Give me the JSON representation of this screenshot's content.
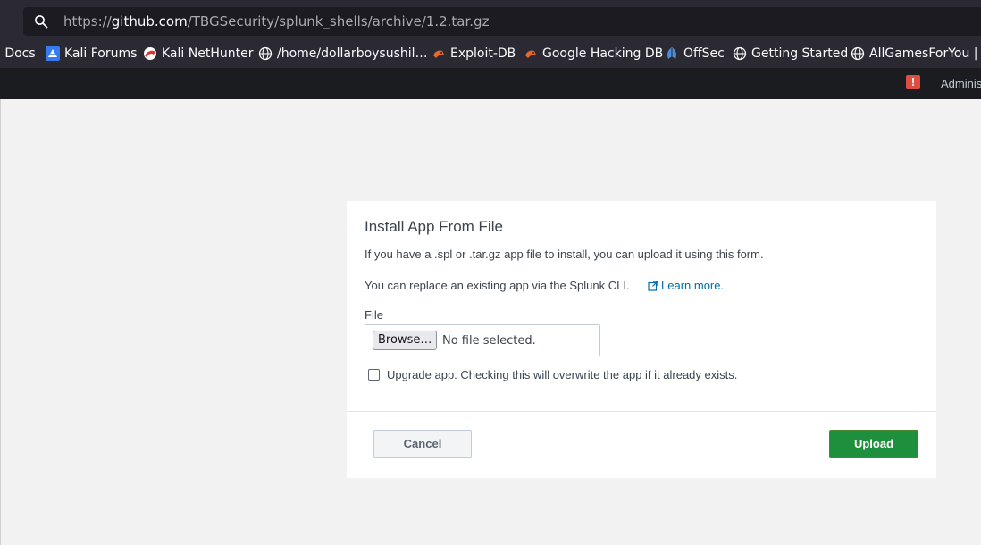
{
  "browser": {
    "url_prefix": "https://",
    "url_host": "github.com",
    "url_path": "/TBGSecurity/splunk_shells/archive/1.2.tar.gz",
    "bookmarks": [
      {
        "label": "i Docs",
        "icon": "none"
      },
      {
        "label": "Kali Forums",
        "icon": "kali-forums-icon"
      },
      {
        "label": "Kali NetHunter",
        "icon": "kali-nethunter-icon"
      },
      {
        "label": "/home/dollarboysushil…",
        "icon": "globe-icon"
      },
      {
        "label": "Exploit-DB",
        "icon": "exploit-db-icon"
      },
      {
        "label": "Google Hacking DB",
        "icon": "ghdb-icon"
      },
      {
        "label": "OffSec",
        "icon": "offsec-icon"
      },
      {
        "label": "Getting Started",
        "icon": "globe-icon"
      },
      {
        "label": "AllGamesForYou | M",
        "icon": "globe-icon"
      }
    ]
  },
  "splunk_bar": {
    "alert_glyph": "!",
    "user_label": "Adminis"
  },
  "form": {
    "title": "Install App From File",
    "description": "If you have a .spl or .tar.gz app file to install, you can upload it using this form.",
    "replace_text": "You can replace an existing app via the Splunk CLI.",
    "learn_more": "Learn more.",
    "file_label": "File",
    "browse_label": "Browse…",
    "no_file_text": "No file selected.",
    "upgrade_label": "Upgrade app. Checking this will overwrite the app if it already exists.",
    "upgrade_checked": false,
    "cancel_label": "Cancel",
    "upload_label": "Upload"
  },
  "colors": {
    "accent_link": "#006eaa",
    "upload_green": "#1e8f3c",
    "alert_red": "#dc4e41"
  }
}
